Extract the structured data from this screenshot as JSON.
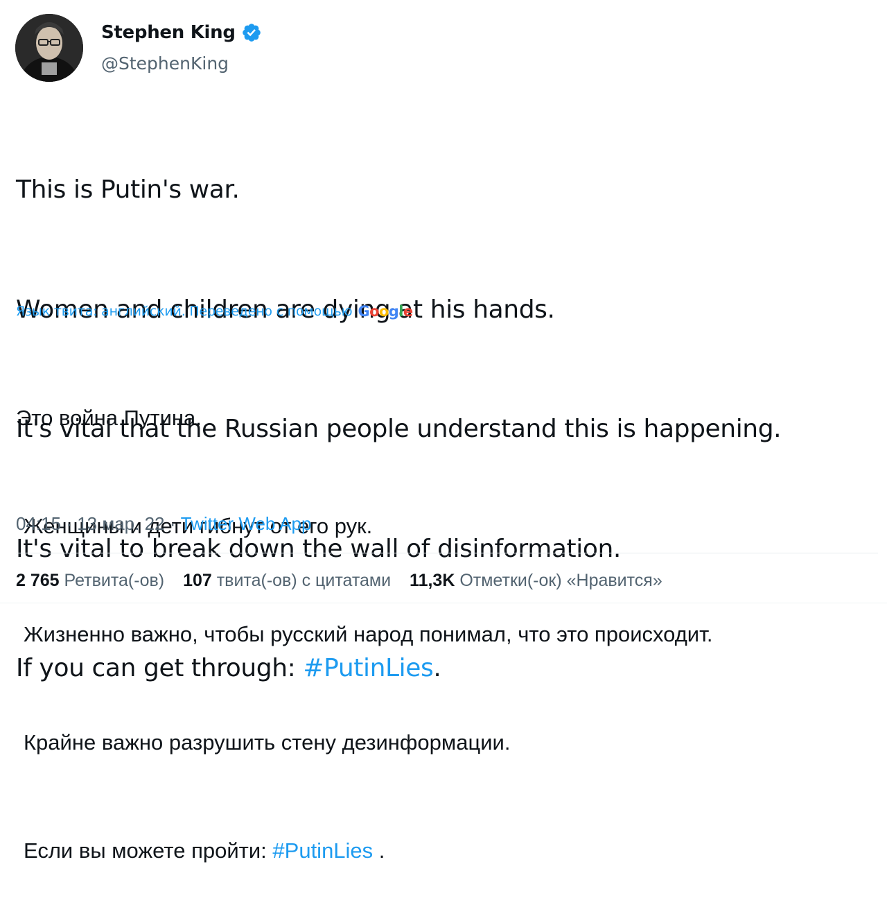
{
  "author": {
    "name": "Stephen King",
    "handle": "@StephenKing",
    "verified": true,
    "verified_color": "#1d9bf0",
    "avatar_icon": "profile-photo"
  },
  "tweet": {
    "lines": [
      "This is Putin's war.",
      "Women and children are dying at his hands.",
      "It's vital that the Russian people understand this is happening.",
      "It's vital to break down the wall of disinformation."
    ],
    "last_line_prefix": "If you can get through: ",
    "hashtag": "#PutinLies",
    "last_line_suffix": "."
  },
  "translation": {
    "note": "Язык твита: английский. Переведено с помощью",
    "provider": "Google",
    "lines": [
      "Это война Путина.",
      "Женщины и дети гибнут от его рук.",
      "Жизненно важно, чтобы русский народ понимал, что это происходит.",
      "Крайне важно разрушить стену дезинформации."
    ],
    "last_line_prefix": "Если вы можете пройти: ",
    "hashtag": "#PutinLies",
    "last_line_suffix": " ."
  },
  "meta": {
    "time": "04:15",
    "separator": " · ",
    "date": "13 мар. 22",
    "source": "Twitter Web App"
  },
  "stats": {
    "retweets_count": "2 765",
    "retweets_label": "Ретвита(-ов)",
    "quotes_count": "107",
    "quotes_label": "твита(-ов) с цитатами",
    "likes_count": "11,3K",
    "likes_label": "Отметки(-ок) «Нравится»"
  },
  "colors": {
    "link": "#1d9bf0",
    "secondary_text": "#536471",
    "primary_text": "#0f1419"
  }
}
